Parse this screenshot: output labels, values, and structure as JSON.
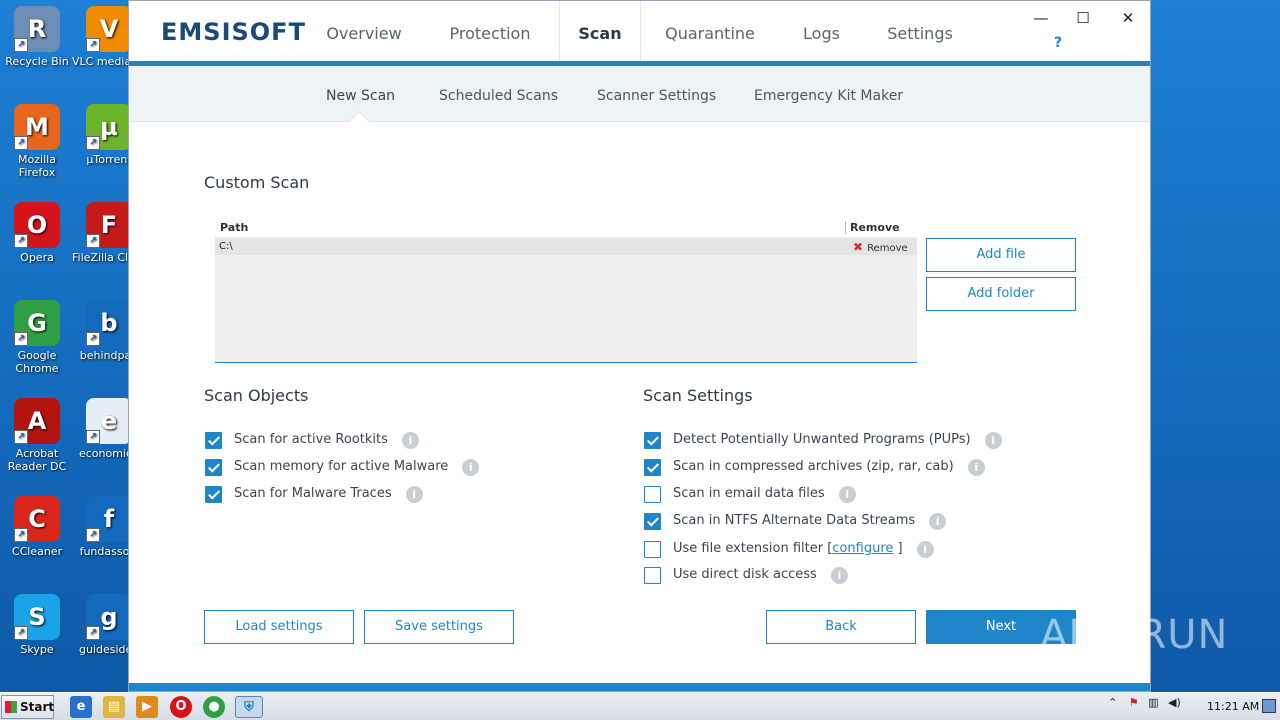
{
  "desktop": {
    "icons_col1": [
      {
        "label": "Recycle Bin",
        "icon": "recycle-bin-icon",
        "color": "#6d8db5"
      },
      {
        "label": "Mozilla Firefox",
        "icon": "firefox-icon",
        "color": "#e8651c"
      },
      {
        "label": "Opera",
        "icon": "opera-icon",
        "color": "#d4131b"
      },
      {
        "label": "Google Chrome",
        "icon": "chrome-icon",
        "color": "#2f9e44"
      },
      {
        "label": "Acrobat Reader DC",
        "icon": "acrobat-icon",
        "color": "#b3140f"
      },
      {
        "label": "CCleaner",
        "icon": "ccleaner-icon",
        "color": "#d9251c"
      },
      {
        "label": "Skype",
        "icon": "skype-icon",
        "color": "#1aa3e8"
      }
    ],
    "icons_col2": [
      {
        "label": "VLC media player",
        "icon": "vlc-icon",
        "color": "#f08a00"
      },
      {
        "label": "µTorrent",
        "icon": "utorrent-icon",
        "color": "#6bb42b"
      },
      {
        "label": "FileZilla Client",
        "icon": "filezilla-icon",
        "color": "#c41a1a"
      },
      {
        "label": "behindpau",
        "icon": "document-icon",
        "color": "#1369bb"
      },
      {
        "label": "economicg",
        "icon": "word-document-icon",
        "color": "#e8eef6"
      },
      {
        "label": "fundassoci",
        "icon": "document-icon",
        "color": "#1369bb"
      },
      {
        "label": "guidesidea",
        "icon": "document-icon",
        "color": "#1369bb"
      }
    ]
  },
  "app": {
    "logo": "EMSISOFT",
    "main_tabs": [
      "Overview",
      "Protection",
      "Scan",
      "Quarantine",
      "Logs",
      "Settings"
    ],
    "active_tab": "Scan",
    "help": "?",
    "window_controls": {
      "minimize": "—",
      "maximize": "☐",
      "close": "✕"
    },
    "sub_tabs": [
      "New Scan",
      "Scheduled Scans",
      "Scanner Settings",
      "Emergency Kit Maker"
    ],
    "active_sub_tab": "New Scan",
    "accent_color": "#1e86c8"
  },
  "custom_scan": {
    "title": "Custom Scan",
    "columns": [
      "Path",
      "Remove"
    ],
    "rows": [
      {
        "path": "C:\\",
        "remove": "Remove"
      }
    ],
    "add_file": "Add file",
    "add_folder": "Add folder"
  },
  "scan_objects": {
    "title": "Scan Objects",
    "options": [
      {
        "label": "Scan for active Rootkits",
        "checked": true
      },
      {
        "label": "Scan memory for active Malware",
        "checked": true
      },
      {
        "label": "Scan for Malware Traces",
        "checked": true
      }
    ]
  },
  "scan_settings": {
    "title": "Scan Settings",
    "options": [
      {
        "label": "Detect Potentially Unwanted Programs (PUPs)",
        "checked": true
      },
      {
        "label": "Scan in compressed archives (zip, rar, cab)",
        "checked": true
      },
      {
        "label": "Scan in email data files",
        "checked": false
      },
      {
        "label": "Scan in NTFS Alternate Data Streams",
        "checked": true
      },
      {
        "label": "Use file extension filter [",
        "checked": false,
        "link": "configure",
        "suffix": " ]"
      },
      {
        "label": "Use direct disk access",
        "checked": false
      }
    ]
  },
  "buttons": {
    "load": "Load settings",
    "save": "Save settings",
    "back": "Back",
    "next": "Next"
  },
  "watermark": "ANY RUN",
  "taskbar": {
    "start": "Start",
    "clock": "11:21 AM"
  }
}
